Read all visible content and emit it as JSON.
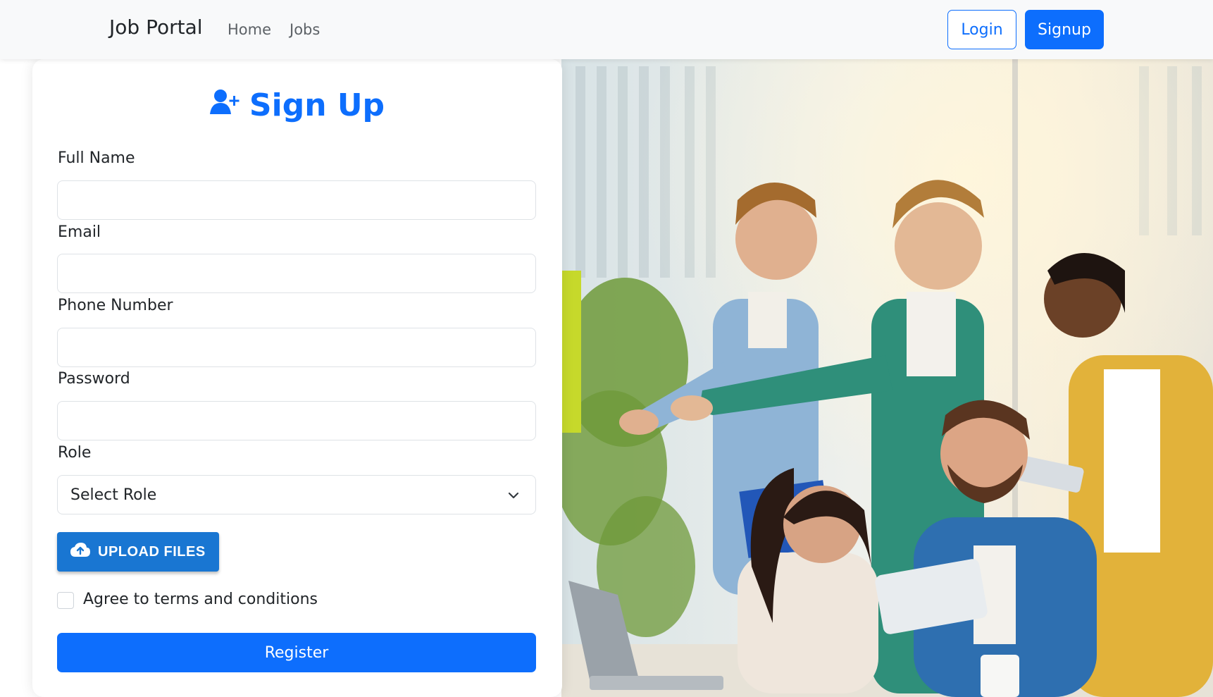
{
  "navbar": {
    "brand": "Job Portal",
    "links": [
      "Home",
      "Jobs"
    ],
    "login_label": "Login",
    "signup_label": "Signup"
  },
  "form": {
    "title": "Sign Up",
    "fields": {
      "full_name_label": "Full Name",
      "email_label": "Email",
      "phone_label": "Phone Number",
      "password_label": "Password",
      "role_label": "Role",
      "role_selected": "Select Role"
    },
    "upload_label": "UPLOAD FILES",
    "terms_label": "Agree to terms and conditions",
    "register_label": "Register"
  },
  "icons": {
    "title_icon": "user-plus-icon",
    "upload_icon": "cloud-upload-icon",
    "select_icon": "chevron-down-icon"
  },
  "colors": {
    "primary": "#0d6efd",
    "upload": "#1976d2"
  }
}
